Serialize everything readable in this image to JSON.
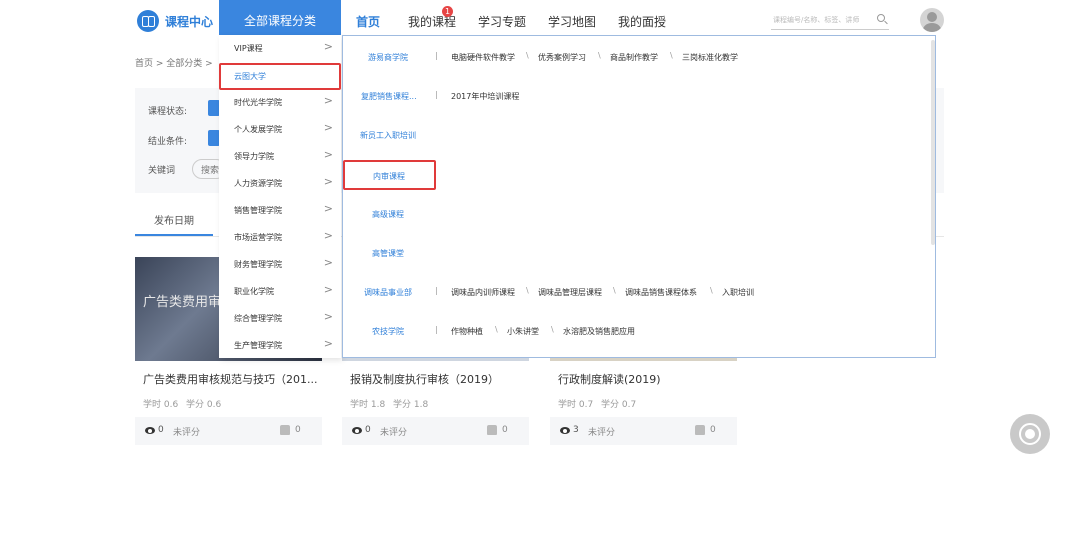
{
  "header": {
    "logo_text": "课程中心",
    "all_categories": "全部课程分类",
    "nav": [
      {
        "label": "首页",
        "active": true
      },
      {
        "label": "我的课程",
        "badge": "1"
      },
      {
        "label": "学习专题"
      },
      {
        "label": "学习地图"
      },
      {
        "label": "我的面授"
      }
    ],
    "search_placeholder": "课程编号/名称、标签、讲师"
  },
  "breadcrumb": "首页 > 全部分类 >",
  "filters": {
    "status_label": "课程状态:",
    "completion_label": "结业条件:",
    "keyword_label": "关键词",
    "keyword_placeholder": "搜索"
  },
  "sort_tab": "发布日期",
  "categories": [
    {
      "label": "VIP课程",
      "chevron": ">"
    },
    {
      "label": "云图大学",
      "selected": true
    },
    {
      "label": "时代光华学院",
      "chevron": ">"
    },
    {
      "label": "个人发展学院",
      "chevron": ">"
    },
    {
      "label": "领导力学院",
      "chevron": ">"
    },
    {
      "label": "人力资源学院",
      "chevron": ">"
    },
    {
      "label": "销售管理学院",
      "chevron": ">"
    },
    {
      "label": "市场运营学院",
      "chevron": ">"
    },
    {
      "label": "财务管理学院",
      "chevron": ">"
    },
    {
      "label": "职业化学院",
      "chevron": ">"
    },
    {
      "label": "综合管理学院",
      "chevron": ">"
    },
    {
      "label": "生产管理学院",
      "chevron": ">"
    }
  ],
  "submenu": [
    {
      "head": "游易商学院",
      "items": [
        "电脑硬件软件教学",
        "优秀案例学习",
        "商品制作教学",
        "三岗标准化教学"
      ]
    },
    {
      "head": "复肥销售课程...",
      "items": [
        "2017年中培训课程"
      ]
    },
    {
      "head": "新员工入职培训",
      "items": []
    },
    {
      "head": "内审课程",
      "items": [],
      "highlighted": true
    },
    {
      "head": "高级课程",
      "items": []
    },
    {
      "head": "高管课堂",
      "items": []
    },
    {
      "head": "调味品事业部",
      "items": [
        "调味品内训师课程",
        "调味品管理层课程",
        "调味品销售课程体系",
        "入职培训"
      ]
    },
    {
      "head": "农技学院",
      "items": [
        "作物种植",
        "小朱讲堂",
        "水溶肥及销售肥应用"
      ]
    }
  ],
  "cards": [
    {
      "title": "广告类费用审核规范与技巧（201...",
      "hours": "学时 0.6",
      "credits": "学分 0.6",
      "views": "0",
      "rating": "未评分",
      "likes": "0",
      "banner": "广告类费用审"
    },
    {
      "title": "报销及制度执行审核（2019）",
      "hours": "学时 1.8",
      "credits": "学分 1.8",
      "views": "0",
      "rating": "未评分",
      "likes": "0"
    },
    {
      "title": "行政制度解读(2019)",
      "hours": "学时 0.7",
      "credits": "学分 0.7",
      "views": "3",
      "rating": "未评分",
      "likes": "0"
    }
  ],
  "colors": {
    "accent": "#3a86df",
    "highlight_box": "#e03a3a"
  }
}
